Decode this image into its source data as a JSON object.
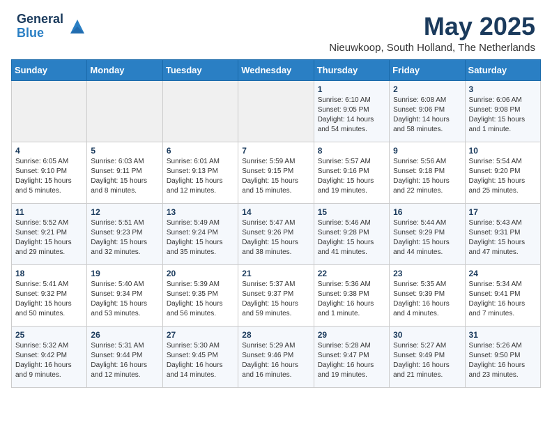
{
  "logo": {
    "general": "General",
    "blue": "Blue"
  },
  "title": {
    "month": "May 2025",
    "location": "Nieuwkoop, South Holland, The Netherlands"
  },
  "weekdays": [
    "Sunday",
    "Monday",
    "Tuesday",
    "Wednesday",
    "Thursday",
    "Friday",
    "Saturday"
  ],
  "weeks": [
    [
      {
        "day": "",
        "info": ""
      },
      {
        "day": "",
        "info": ""
      },
      {
        "day": "",
        "info": ""
      },
      {
        "day": "",
        "info": ""
      },
      {
        "day": "1",
        "info": "Sunrise: 6:10 AM\nSunset: 9:05 PM\nDaylight: 14 hours\nand 54 minutes."
      },
      {
        "day": "2",
        "info": "Sunrise: 6:08 AM\nSunset: 9:06 PM\nDaylight: 14 hours\nand 58 minutes."
      },
      {
        "day": "3",
        "info": "Sunrise: 6:06 AM\nSunset: 9:08 PM\nDaylight: 15 hours\nand 1 minute."
      }
    ],
    [
      {
        "day": "4",
        "info": "Sunrise: 6:05 AM\nSunset: 9:10 PM\nDaylight: 15 hours\nand 5 minutes."
      },
      {
        "day": "5",
        "info": "Sunrise: 6:03 AM\nSunset: 9:11 PM\nDaylight: 15 hours\nand 8 minutes."
      },
      {
        "day": "6",
        "info": "Sunrise: 6:01 AM\nSunset: 9:13 PM\nDaylight: 15 hours\nand 12 minutes."
      },
      {
        "day": "7",
        "info": "Sunrise: 5:59 AM\nSunset: 9:15 PM\nDaylight: 15 hours\nand 15 minutes."
      },
      {
        "day": "8",
        "info": "Sunrise: 5:57 AM\nSunset: 9:16 PM\nDaylight: 15 hours\nand 19 minutes."
      },
      {
        "day": "9",
        "info": "Sunrise: 5:56 AM\nSunset: 9:18 PM\nDaylight: 15 hours\nand 22 minutes."
      },
      {
        "day": "10",
        "info": "Sunrise: 5:54 AM\nSunset: 9:20 PM\nDaylight: 15 hours\nand 25 minutes."
      }
    ],
    [
      {
        "day": "11",
        "info": "Sunrise: 5:52 AM\nSunset: 9:21 PM\nDaylight: 15 hours\nand 29 minutes."
      },
      {
        "day": "12",
        "info": "Sunrise: 5:51 AM\nSunset: 9:23 PM\nDaylight: 15 hours\nand 32 minutes."
      },
      {
        "day": "13",
        "info": "Sunrise: 5:49 AM\nSunset: 9:24 PM\nDaylight: 15 hours\nand 35 minutes."
      },
      {
        "day": "14",
        "info": "Sunrise: 5:47 AM\nSunset: 9:26 PM\nDaylight: 15 hours\nand 38 minutes."
      },
      {
        "day": "15",
        "info": "Sunrise: 5:46 AM\nSunset: 9:28 PM\nDaylight: 15 hours\nand 41 minutes."
      },
      {
        "day": "16",
        "info": "Sunrise: 5:44 AM\nSunset: 9:29 PM\nDaylight: 15 hours\nand 44 minutes."
      },
      {
        "day": "17",
        "info": "Sunrise: 5:43 AM\nSunset: 9:31 PM\nDaylight: 15 hours\nand 47 minutes."
      }
    ],
    [
      {
        "day": "18",
        "info": "Sunrise: 5:41 AM\nSunset: 9:32 PM\nDaylight: 15 hours\nand 50 minutes."
      },
      {
        "day": "19",
        "info": "Sunrise: 5:40 AM\nSunset: 9:34 PM\nDaylight: 15 hours\nand 53 minutes."
      },
      {
        "day": "20",
        "info": "Sunrise: 5:39 AM\nSunset: 9:35 PM\nDaylight: 15 hours\nand 56 minutes."
      },
      {
        "day": "21",
        "info": "Sunrise: 5:37 AM\nSunset: 9:37 PM\nDaylight: 15 hours\nand 59 minutes."
      },
      {
        "day": "22",
        "info": "Sunrise: 5:36 AM\nSunset: 9:38 PM\nDaylight: 16 hours\nand 1 minute."
      },
      {
        "day": "23",
        "info": "Sunrise: 5:35 AM\nSunset: 9:39 PM\nDaylight: 16 hours\nand 4 minutes."
      },
      {
        "day": "24",
        "info": "Sunrise: 5:34 AM\nSunset: 9:41 PM\nDaylight: 16 hours\nand 7 minutes."
      }
    ],
    [
      {
        "day": "25",
        "info": "Sunrise: 5:32 AM\nSunset: 9:42 PM\nDaylight: 16 hours\nand 9 minutes."
      },
      {
        "day": "26",
        "info": "Sunrise: 5:31 AM\nSunset: 9:44 PM\nDaylight: 16 hours\nand 12 minutes."
      },
      {
        "day": "27",
        "info": "Sunrise: 5:30 AM\nSunset: 9:45 PM\nDaylight: 16 hours\nand 14 minutes."
      },
      {
        "day": "28",
        "info": "Sunrise: 5:29 AM\nSunset: 9:46 PM\nDaylight: 16 hours\nand 16 minutes."
      },
      {
        "day": "29",
        "info": "Sunrise: 5:28 AM\nSunset: 9:47 PM\nDaylight: 16 hours\nand 19 minutes."
      },
      {
        "day": "30",
        "info": "Sunrise: 5:27 AM\nSunset: 9:49 PM\nDaylight: 16 hours\nand 21 minutes."
      },
      {
        "day": "31",
        "info": "Sunrise: 5:26 AM\nSunset: 9:50 PM\nDaylight: 16 hours\nand 23 minutes."
      }
    ]
  ]
}
